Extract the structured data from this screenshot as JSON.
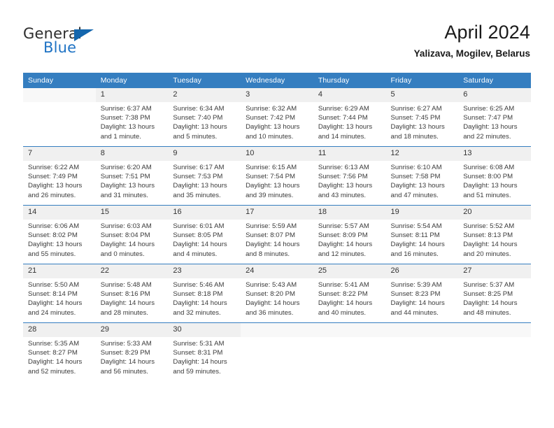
{
  "brand": {
    "name_part1": "General",
    "name_part2": "Blue",
    "accent_color": "#1466ad"
  },
  "header": {
    "title": "April 2024",
    "subtitle": "Yalizava, Mogilev, Belarus"
  },
  "calendar": {
    "header_bg": "#357ec0",
    "weekday_headers": [
      "Sunday",
      "Monday",
      "Tuesday",
      "Wednesday",
      "Thursday",
      "Friday",
      "Saturday"
    ],
    "labels": {
      "sunrise": "Sunrise:",
      "sunset": "Sunset:",
      "daylight": "Daylight:"
    },
    "weeks": [
      [
        {
          "day": ""
        },
        {
          "day": "1",
          "sunrise": "Sunrise: 6:37 AM",
          "sunset": "Sunset: 7:38 PM",
          "daylight_line1": "Daylight: 13 hours",
          "daylight_line2": "and 1 minute."
        },
        {
          "day": "2",
          "sunrise": "Sunrise: 6:34 AM",
          "sunset": "Sunset: 7:40 PM",
          "daylight_line1": "Daylight: 13 hours",
          "daylight_line2": "and 5 minutes."
        },
        {
          "day": "3",
          "sunrise": "Sunrise: 6:32 AM",
          "sunset": "Sunset: 7:42 PM",
          "daylight_line1": "Daylight: 13 hours",
          "daylight_line2": "and 10 minutes."
        },
        {
          "day": "4",
          "sunrise": "Sunrise: 6:29 AM",
          "sunset": "Sunset: 7:44 PM",
          "daylight_line1": "Daylight: 13 hours",
          "daylight_line2": "and 14 minutes."
        },
        {
          "day": "5",
          "sunrise": "Sunrise: 6:27 AM",
          "sunset": "Sunset: 7:45 PM",
          "daylight_line1": "Daylight: 13 hours",
          "daylight_line2": "and 18 minutes."
        },
        {
          "day": "6",
          "sunrise": "Sunrise: 6:25 AM",
          "sunset": "Sunset: 7:47 PM",
          "daylight_line1": "Daylight: 13 hours",
          "daylight_line2": "and 22 minutes."
        }
      ],
      [
        {
          "day": "7",
          "sunrise": "Sunrise: 6:22 AM",
          "sunset": "Sunset: 7:49 PM",
          "daylight_line1": "Daylight: 13 hours",
          "daylight_line2": "and 26 minutes."
        },
        {
          "day": "8",
          "sunrise": "Sunrise: 6:20 AM",
          "sunset": "Sunset: 7:51 PM",
          "daylight_line1": "Daylight: 13 hours",
          "daylight_line2": "and 31 minutes."
        },
        {
          "day": "9",
          "sunrise": "Sunrise: 6:17 AM",
          "sunset": "Sunset: 7:53 PM",
          "daylight_line1": "Daylight: 13 hours",
          "daylight_line2": "and 35 minutes."
        },
        {
          "day": "10",
          "sunrise": "Sunrise: 6:15 AM",
          "sunset": "Sunset: 7:54 PM",
          "daylight_line1": "Daylight: 13 hours",
          "daylight_line2": "and 39 minutes."
        },
        {
          "day": "11",
          "sunrise": "Sunrise: 6:13 AM",
          "sunset": "Sunset: 7:56 PM",
          "daylight_line1": "Daylight: 13 hours",
          "daylight_line2": "and 43 minutes."
        },
        {
          "day": "12",
          "sunrise": "Sunrise: 6:10 AM",
          "sunset": "Sunset: 7:58 PM",
          "daylight_line1": "Daylight: 13 hours",
          "daylight_line2": "and 47 minutes."
        },
        {
          "day": "13",
          "sunrise": "Sunrise: 6:08 AM",
          "sunset": "Sunset: 8:00 PM",
          "daylight_line1": "Daylight: 13 hours",
          "daylight_line2": "and 51 minutes."
        }
      ],
      [
        {
          "day": "14",
          "sunrise": "Sunrise: 6:06 AM",
          "sunset": "Sunset: 8:02 PM",
          "daylight_line1": "Daylight: 13 hours",
          "daylight_line2": "and 55 minutes."
        },
        {
          "day": "15",
          "sunrise": "Sunrise: 6:03 AM",
          "sunset": "Sunset: 8:04 PM",
          "daylight_line1": "Daylight: 14 hours",
          "daylight_line2": "and 0 minutes."
        },
        {
          "day": "16",
          "sunrise": "Sunrise: 6:01 AM",
          "sunset": "Sunset: 8:05 PM",
          "daylight_line1": "Daylight: 14 hours",
          "daylight_line2": "and 4 minutes."
        },
        {
          "day": "17",
          "sunrise": "Sunrise: 5:59 AM",
          "sunset": "Sunset: 8:07 PM",
          "daylight_line1": "Daylight: 14 hours",
          "daylight_line2": "and 8 minutes."
        },
        {
          "day": "18",
          "sunrise": "Sunrise: 5:57 AM",
          "sunset": "Sunset: 8:09 PM",
          "daylight_line1": "Daylight: 14 hours",
          "daylight_line2": "and 12 minutes."
        },
        {
          "day": "19",
          "sunrise": "Sunrise: 5:54 AM",
          "sunset": "Sunset: 8:11 PM",
          "daylight_line1": "Daylight: 14 hours",
          "daylight_line2": "and 16 minutes."
        },
        {
          "day": "20",
          "sunrise": "Sunrise: 5:52 AM",
          "sunset": "Sunset: 8:13 PM",
          "daylight_line1": "Daylight: 14 hours",
          "daylight_line2": "and 20 minutes."
        }
      ],
      [
        {
          "day": "21",
          "sunrise": "Sunrise: 5:50 AM",
          "sunset": "Sunset: 8:14 PM",
          "daylight_line1": "Daylight: 14 hours",
          "daylight_line2": "and 24 minutes."
        },
        {
          "day": "22",
          "sunrise": "Sunrise: 5:48 AM",
          "sunset": "Sunset: 8:16 PM",
          "daylight_line1": "Daylight: 14 hours",
          "daylight_line2": "and 28 minutes."
        },
        {
          "day": "23",
          "sunrise": "Sunrise: 5:46 AM",
          "sunset": "Sunset: 8:18 PM",
          "daylight_line1": "Daylight: 14 hours",
          "daylight_line2": "and 32 minutes."
        },
        {
          "day": "24",
          "sunrise": "Sunrise: 5:43 AM",
          "sunset": "Sunset: 8:20 PM",
          "daylight_line1": "Daylight: 14 hours",
          "daylight_line2": "and 36 minutes."
        },
        {
          "day": "25",
          "sunrise": "Sunrise: 5:41 AM",
          "sunset": "Sunset: 8:22 PM",
          "daylight_line1": "Daylight: 14 hours",
          "daylight_line2": "and 40 minutes."
        },
        {
          "day": "26",
          "sunrise": "Sunrise: 5:39 AM",
          "sunset": "Sunset: 8:23 PM",
          "daylight_line1": "Daylight: 14 hours",
          "daylight_line2": "and 44 minutes."
        },
        {
          "day": "27",
          "sunrise": "Sunrise: 5:37 AM",
          "sunset": "Sunset: 8:25 PM",
          "daylight_line1": "Daylight: 14 hours",
          "daylight_line2": "and 48 minutes."
        }
      ],
      [
        {
          "day": "28",
          "sunrise": "Sunrise: 5:35 AM",
          "sunset": "Sunset: 8:27 PM",
          "daylight_line1": "Daylight: 14 hours",
          "daylight_line2": "and 52 minutes."
        },
        {
          "day": "29",
          "sunrise": "Sunrise: 5:33 AM",
          "sunset": "Sunset: 8:29 PM",
          "daylight_line1": "Daylight: 14 hours",
          "daylight_line2": "and 56 minutes."
        },
        {
          "day": "30",
          "sunrise": "Sunrise: 5:31 AM",
          "sunset": "Sunset: 8:31 PM",
          "daylight_line1": "Daylight: 14 hours",
          "daylight_line2": "and 59 minutes."
        },
        {
          "day": ""
        },
        {
          "day": ""
        },
        {
          "day": ""
        },
        {
          "day": ""
        }
      ]
    ]
  }
}
